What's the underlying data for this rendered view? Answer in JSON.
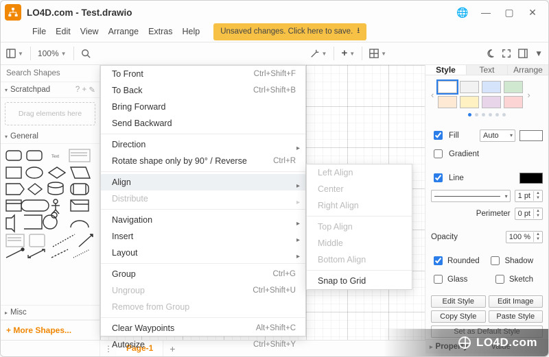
{
  "title": "LO4D.com - Test.drawio",
  "menubar": [
    "File",
    "Edit",
    "View",
    "Arrange",
    "Extras",
    "Help"
  ],
  "save_banner": "Unsaved changes. Click here to save.",
  "toolbar": {
    "zoom": "100%"
  },
  "left": {
    "search_placeholder": "Search Shapes",
    "scratchpad_label": "Scratchpad",
    "scratchpad_hint": "Drag elements here",
    "general_label": "General",
    "misc_label": "Misc",
    "more_shapes": "+  More Shapes..."
  },
  "arrange_menu": [
    {
      "label": "To Front",
      "shortcut": "Ctrl+Shift+F"
    },
    {
      "label": "To Back",
      "shortcut": "Ctrl+Shift+B"
    },
    {
      "label": "Bring Forward"
    },
    {
      "label": "Send Backward"
    },
    {
      "sep": true
    },
    {
      "label": "Direction",
      "submenu": true
    },
    {
      "label": "Rotate shape only by 90° / Reverse",
      "shortcut": "Ctrl+R"
    },
    {
      "sep": true
    },
    {
      "label": "Align",
      "submenu": true,
      "hover": true
    },
    {
      "label": "Distribute",
      "submenu": true,
      "disabled": true
    },
    {
      "sep": true
    },
    {
      "label": "Navigation",
      "submenu": true
    },
    {
      "label": "Insert",
      "submenu": true
    },
    {
      "label": "Layout",
      "submenu": true
    },
    {
      "sep": true
    },
    {
      "label": "Group",
      "shortcut": "Ctrl+G"
    },
    {
      "label": "Ungroup",
      "shortcut": "Ctrl+Shift+U",
      "disabled": true
    },
    {
      "label": "Remove from Group",
      "disabled": true
    },
    {
      "sep": true
    },
    {
      "label": "Clear Waypoints",
      "shortcut": "Alt+Shift+C"
    },
    {
      "label": "Autosize",
      "shortcut": "Ctrl+Shift+Y"
    }
  ],
  "align_submenu": [
    {
      "label": "Left Align",
      "disabled": true
    },
    {
      "label": "Center",
      "disabled": true
    },
    {
      "label": "Right Align",
      "disabled": true
    },
    {
      "sep": true
    },
    {
      "label": "Top Align",
      "disabled": true
    },
    {
      "label": "Middle",
      "disabled": true
    },
    {
      "label": "Bottom Align",
      "disabled": true
    },
    {
      "sep": true
    },
    {
      "label": "Snap to Grid"
    }
  ],
  "right": {
    "tabs": [
      "Style",
      "Text",
      "Arrange"
    ],
    "swatch_colors": [
      "#ffffff",
      "#f2f2f2",
      "#d5e3fb",
      "#cfe8cf",
      "#feead4",
      "#fff1c1",
      "#e8d5ea",
      "#fcd4d4"
    ],
    "fill_label": "Fill",
    "fill_mode": "Auto",
    "gradient_label": "Gradient",
    "line_label": "Line",
    "line_width": "1 pt",
    "perimeter_label": "Perimeter",
    "perimeter_val": "0 pt",
    "opacity_label": "Opacity",
    "opacity_val": "100 %",
    "rounded": "Rounded",
    "shadow": "Shadow",
    "glass": "Glass",
    "sketch": "Sketch",
    "edit_style": "Edit Style",
    "edit_image": "Edit Image",
    "copy_style": "Copy Style",
    "paste_style": "Paste Style",
    "default_style": "Set as Default Style",
    "prop_key": "Property",
    "prop_val": "Value"
  },
  "footer": {
    "page": "Page-1"
  },
  "watermark": "LO4D.com"
}
